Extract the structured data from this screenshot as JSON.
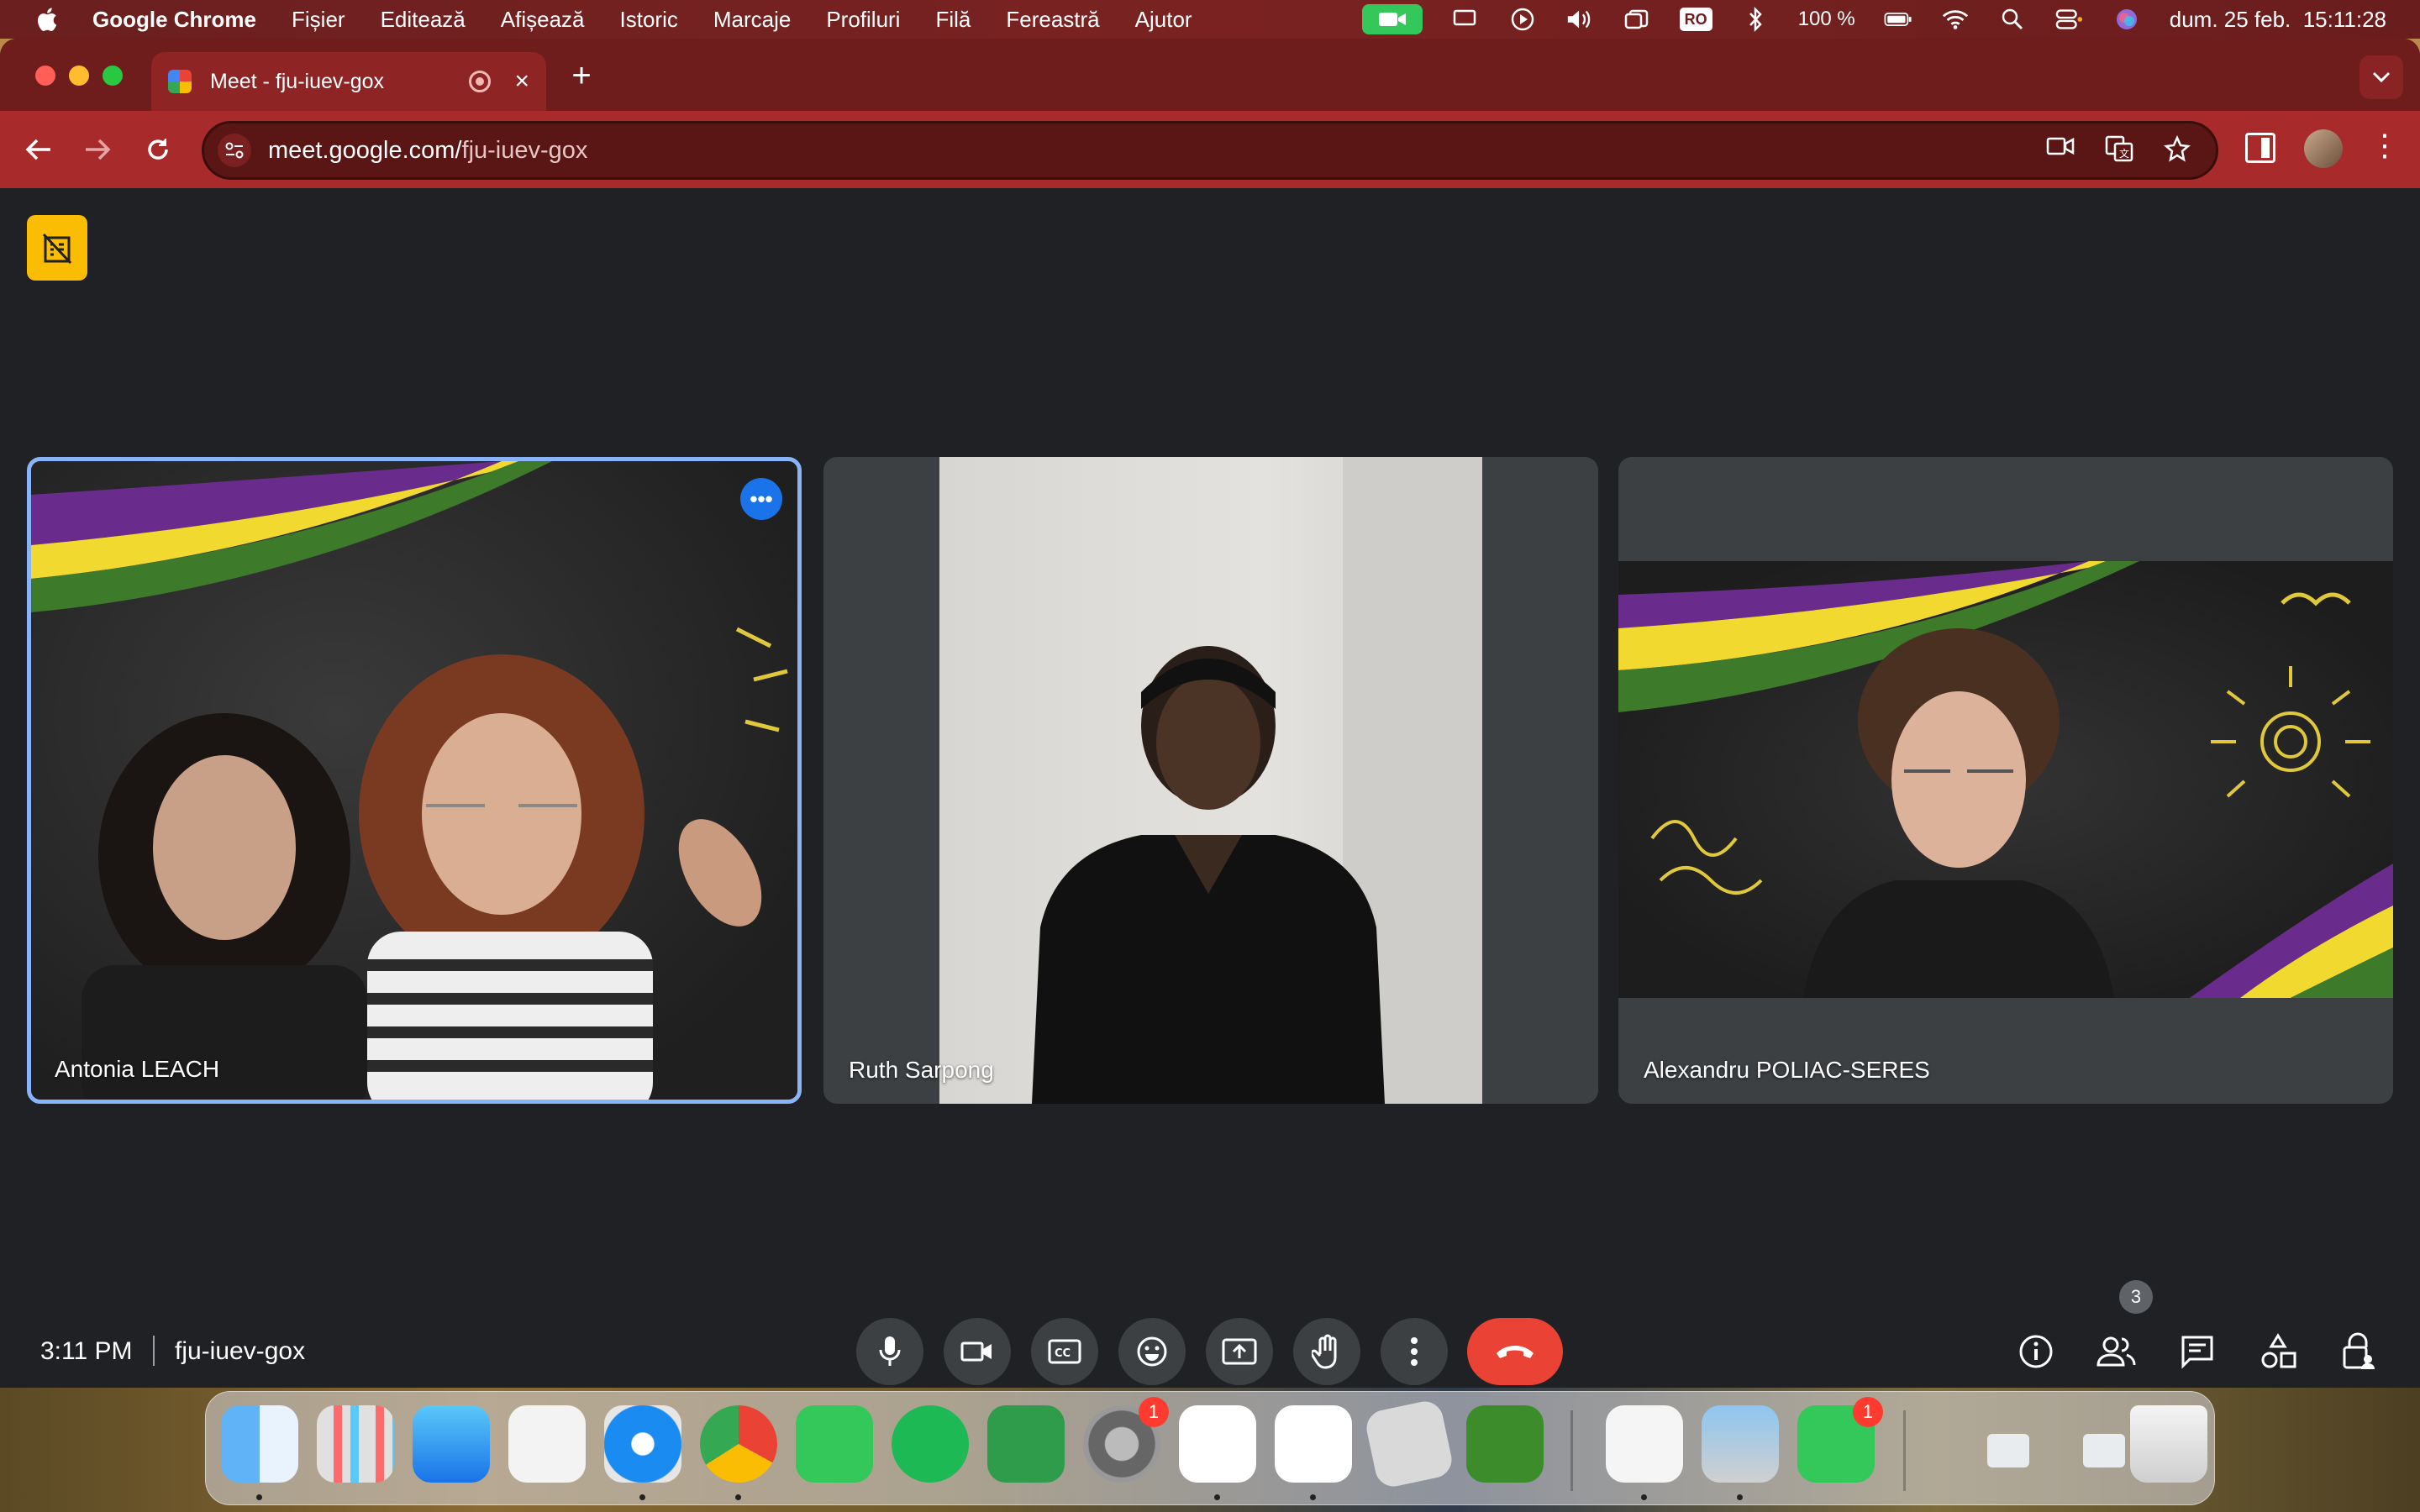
{
  "menubar": {
    "app_name": "Google Chrome",
    "items": [
      "Fișier",
      "Editează",
      "Afișează",
      "Istoric",
      "Marcaje",
      "Profiluri",
      "Filă",
      "Fereastră",
      "Ajutor"
    ],
    "keyboard_layout": "RO",
    "battery": "100 %",
    "datetime": "dum. 25 feb.  15:11:28"
  },
  "browser": {
    "tab_title": "Meet - fju-iuev-gox",
    "url_host": "meet.google.com/",
    "url_path": "fju-iuev-gox",
    "new_tab_label": "+"
  },
  "meet": {
    "participants": [
      {
        "name": "Antonia LEACH"
      },
      {
        "name": "Ruth Sarpong"
      },
      {
        "name": "Alexandru POLIAC-SERES"
      }
    ],
    "time": "3:11 PM",
    "meeting_code": "fju-iuev-gox",
    "people_count": "3"
  },
  "dock": {
    "badges": {
      "settings": "1",
      "facetime": "1"
    }
  },
  "colors": {
    "meet_bg": "#202124",
    "control_bg": "#3c4043",
    "leave_red": "#ea4335",
    "active_tile_border": "#8ab4f8",
    "tab_strip": "#6e1c1c",
    "toolbar": "#a82a2a"
  }
}
